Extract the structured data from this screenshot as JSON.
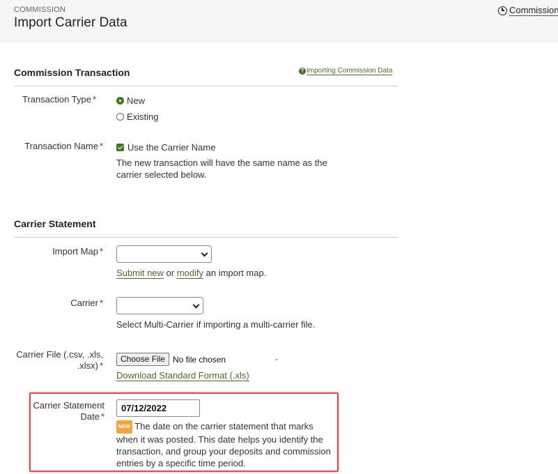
{
  "header": {
    "breadcrumb": "COMMISSION",
    "title": "Import Carrier Data",
    "history_link": "Commission"
  },
  "transaction_section": {
    "title": "Commission Transaction",
    "help_link": "Importing Commission Data",
    "transaction_type": {
      "label": "Transaction Type",
      "options": [
        "New",
        "Existing"
      ],
      "selected": "New"
    },
    "transaction_name": {
      "label": "Transaction Name",
      "checkbox_label": "Use the Carrier Name",
      "checked": true,
      "help_text": "The new transaction will have the same name as the carrier selected below."
    }
  },
  "statement_section": {
    "title": "Carrier Statement",
    "import_map": {
      "label": "Import Map",
      "value": "",
      "help_submit": "Submit new",
      "help_or": " or ",
      "help_modify": "modify",
      "help_tail": " an import map."
    },
    "carrier": {
      "label": "Carrier",
      "value": "",
      "help_text": "Select Multi-Carrier if importing a multi-carrier file."
    },
    "carrier_file": {
      "label_line1": "Carrier File (.csv, .xls,",
      "label_line2": ".xlsx)",
      "button_label": "Choose File",
      "status": "No file chosen",
      "dash": "-",
      "download_link": "Download Standard Format (.xls)"
    },
    "statement_date": {
      "label_line1": "Carrier Statement",
      "label_line2": "Date",
      "value": "07/12/2022",
      "badge": "NEW",
      "help_text": "The date on the carrier statement that marks when it was posted. This date helps you identify the transaction, and group your deposits and commission entries by a specific time period."
    }
  },
  "required_mark": "*",
  "colors": {
    "accent_green": "#3f7a1f",
    "link_green": "#4a6b26",
    "required_red": "#a01c2a",
    "highlight_red": "#e2474b",
    "badge_orange": "#f0a63a"
  }
}
